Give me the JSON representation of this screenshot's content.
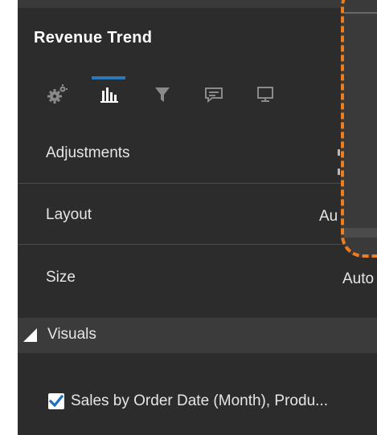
{
  "panel": {
    "title": "Revenue Trend",
    "tabs": [
      {
        "icon": "gear-icon",
        "active": false
      },
      {
        "icon": "bar-chart-icon",
        "active": true
      },
      {
        "icon": "filter-icon",
        "active": false
      },
      {
        "icon": "comment-icon",
        "active": false
      },
      {
        "icon": "presentation-icon",
        "active": false
      }
    ],
    "rows": [
      {
        "label": "Adjustments",
        "value": ""
      },
      {
        "label": "Layout",
        "value": "Au"
      },
      {
        "label": "Size",
        "value": "Auto"
      }
    ],
    "section": {
      "title": "Visuals",
      "items": [
        {
          "label": "Sales by Order Date (Month), Produ...",
          "checked": true
        }
      ]
    }
  },
  "colors": {
    "panel_bg": "#2c2c2c",
    "accent": "#2b78b8",
    "highlight_dash": "#ef7d1e"
  }
}
